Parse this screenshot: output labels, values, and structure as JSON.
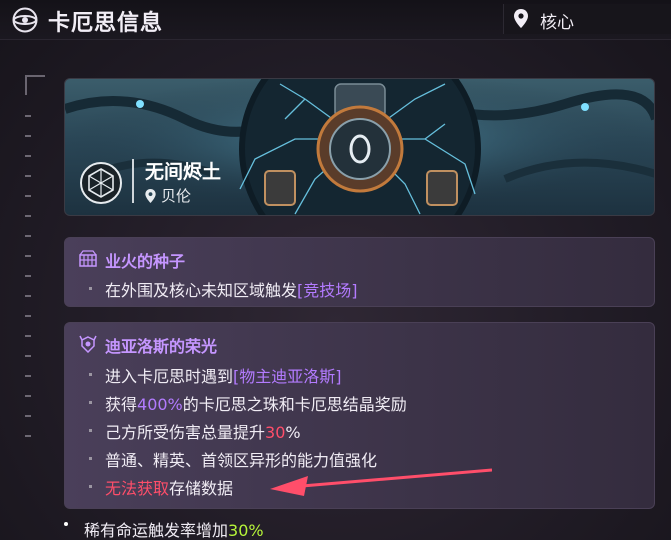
{
  "header": {
    "title": "卡厄思信息",
    "location": "核心"
  },
  "banner": {
    "region_name": "无间烬土",
    "region_sub": "贝伦"
  },
  "card1": {
    "title": "业火的种子",
    "line1": {
      "prefix": "在外围及核心未知区域触发",
      "link": "[竞技场]"
    }
  },
  "card2": {
    "title": "迪亚洛斯的荣光",
    "line1": {
      "prefix": "进入卡厄思时遇到",
      "link": "[物主迪亚洛斯]"
    },
    "line2": {
      "prefix": "获得",
      "value": "400%",
      "suffix": "的卡厄思之珠和卡厄思结晶奖励"
    },
    "line3": {
      "prefix": "己方所受伤害总量提升",
      "value": "30",
      "suffix": "%"
    },
    "line4": "普通、精英、首领区异形的能力值强化",
    "line5": {
      "warn": "无法获取",
      "suffix": "存储数据"
    }
  },
  "bottom": {
    "prefix": "稀有命运触发率增加",
    "value": "30%"
  },
  "colors": {
    "accent_purple": "#b37bff",
    "title_purple": "#c596ff",
    "warn_red": "#ff4e6a",
    "bonus_green": "#b6f53a"
  }
}
